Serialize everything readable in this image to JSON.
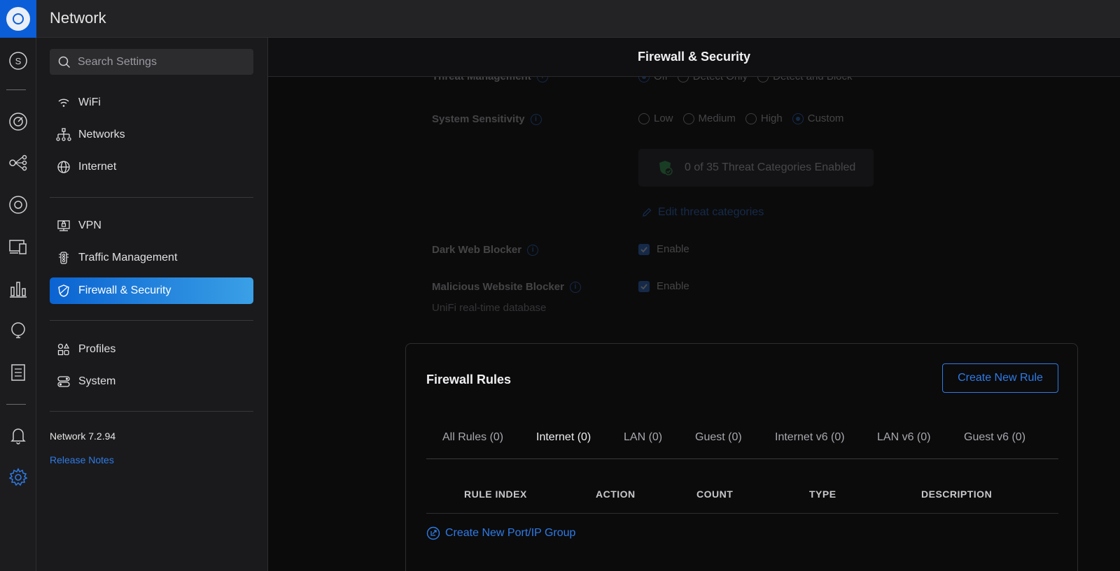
{
  "app": {
    "title": "Network"
  },
  "rail": {
    "user_initial": "S",
    "icons": [
      "user-avatar-icon",
      "dashboard-icon",
      "topology-icon",
      "devices-icon",
      "clients-icon",
      "statistics-icon",
      "insights-icon",
      "logs-icon",
      "notifications-icon",
      "settings-icon"
    ],
    "active_color": "#2f7be6"
  },
  "settings": {
    "search_placeholder": "Search Settings",
    "groups": [
      [
        {
          "label": "WiFi",
          "icon": "wifi-icon"
        },
        {
          "label": "Networks",
          "icon": "networks-icon"
        },
        {
          "label": "Internet",
          "icon": "globe-icon"
        }
      ],
      [
        {
          "label": "VPN",
          "icon": "vpn-icon"
        },
        {
          "label": "Traffic Management",
          "icon": "traffic-icon"
        },
        {
          "label": "Firewall & Security",
          "icon": "shield-icon",
          "active": true
        }
      ],
      [
        {
          "label": "Profiles",
          "icon": "profiles-icon"
        },
        {
          "label": "System",
          "icon": "system-icon"
        }
      ]
    ],
    "version": "Network 7.2.94",
    "release_notes": "Release Notes"
  },
  "page": {
    "title": "Firewall & Security",
    "threat_management": {
      "label": "Threat Management",
      "options": [
        "Off",
        "Detect Only",
        "Detect and Block"
      ],
      "selected": "Off"
    },
    "system_sensitivity": {
      "label": "System Sensitivity",
      "options": [
        "Low",
        "Medium",
        "High",
        "Custom"
      ],
      "selected": "Custom"
    },
    "threat_categories": "0 of 35 Threat Categories Enabled",
    "edit_threat_categories": "Edit threat categories",
    "dark_web_blocker": {
      "label": "Dark Web Blocker",
      "checkbox": "Enable",
      "checked": true
    },
    "malicious_website_blocker": {
      "label": "Malicious Website Blocker",
      "sub": "UniFi real-time database",
      "checkbox": "Enable",
      "checked": true
    }
  },
  "firewall_rules": {
    "title": "Firewall Rules",
    "create_button": "Create New Rule",
    "tabs": [
      "All Rules (0)",
      "Internet (0)",
      "LAN (0)",
      "Guest (0)",
      "Internet v6 (0)",
      "LAN v6 (0)",
      "Guest v6 (0)"
    ],
    "active_tab": "Internet (0)",
    "columns": [
      "RULE INDEX",
      "ACTION",
      "COUNT",
      "TYPE",
      "DESCRIPTION"
    ],
    "create_group_link": "Create New Port/IP Group"
  }
}
